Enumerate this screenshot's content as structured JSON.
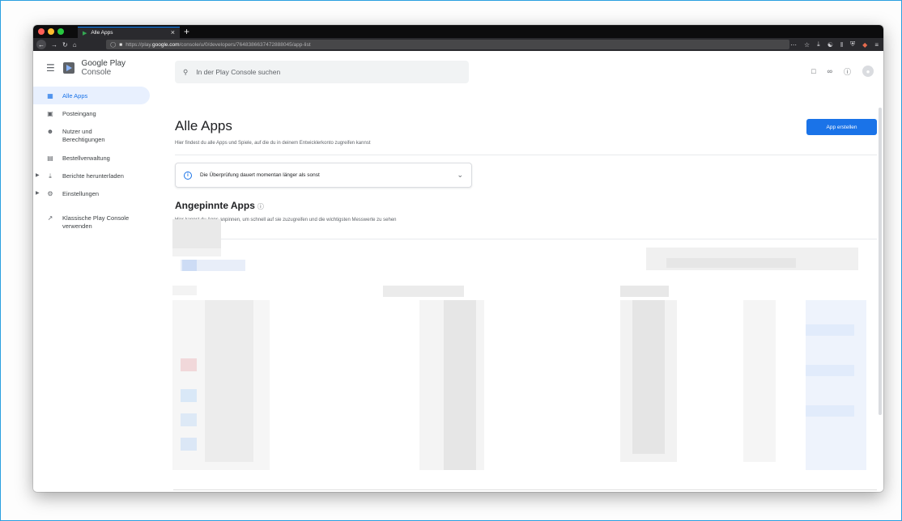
{
  "browser": {
    "tab_title": "Alle Apps",
    "url_prefix": "https://play.",
    "url_host": "google.com",
    "url_path": "/console/u/0/developers/7648386637472888045/app-list"
  },
  "brand": {
    "google": "Google Play",
    "console": " Console"
  },
  "search": {
    "placeholder": "In der Play Console suchen"
  },
  "sidebar": {
    "items": [
      {
        "label": "Alle Apps"
      },
      {
        "label": "Posteingang"
      },
      {
        "label": "Nutzer und Berechtigungen"
      },
      {
        "label": "Bestellverwaltung"
      },
      {
        "label": "Berichte herunterladen"
      },
      {
        "label": "Einstellungen"
      },
      {
        "label": "Klassische Play Console verwenden"
      }
    ]
  },
  "page": {
    "title": "Alle Apps",
    "subtitle": "Hier findest du alle Apps und Spiele, auf die du in deinem Entwicklerkonto zugreifen kannst",
    "create_button": "App erstellen",
    "banner_text": "Die Überprüfung dauert momentan länger als sonst",
    "pinned_title": "Angepinnte Apps",
    "pinned_subtitle": "Hier kannst du Apps anpinnen, um schnell auf sie zuzugreifen und die wichtigsten Messwerte zu sehen"
  },
  "colors": {
    "accent": "#1a73e8",
    "active_bg": "#e8f0fe"
  }
}
